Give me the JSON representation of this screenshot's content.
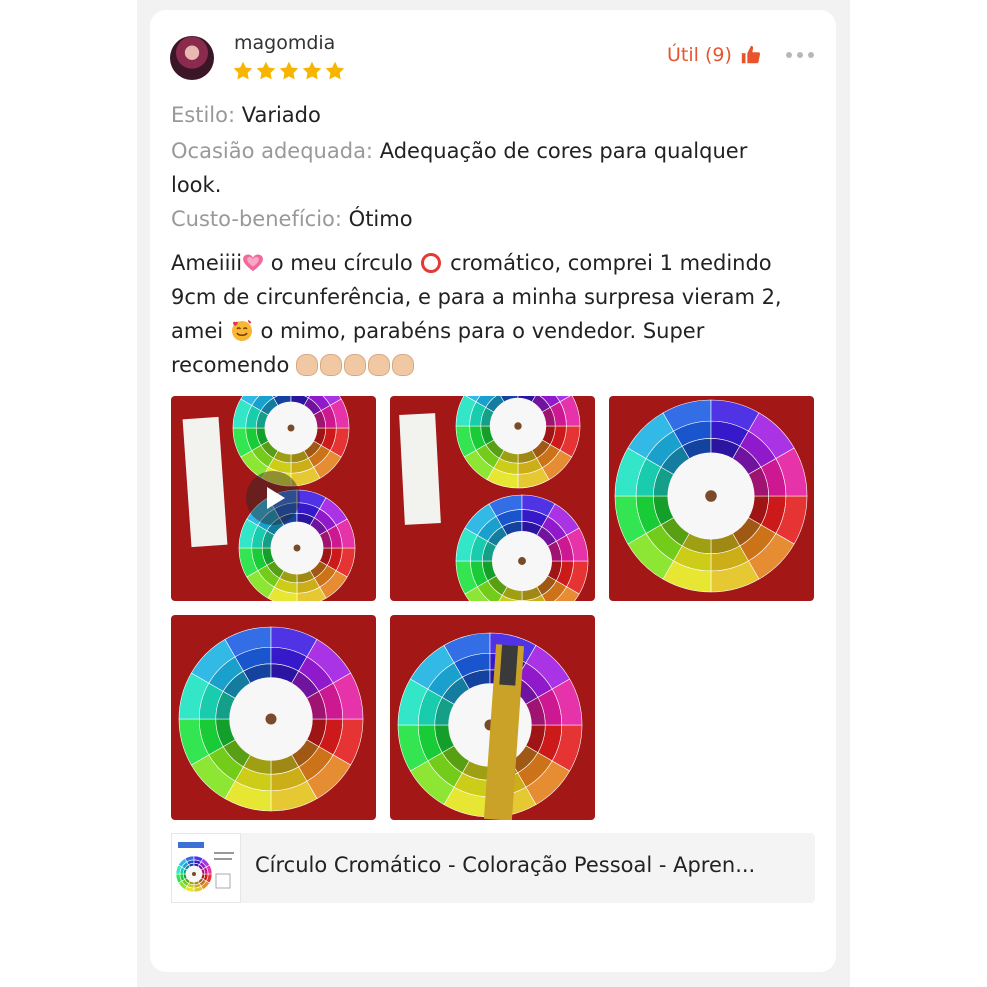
{
  "review": {
    "username": "magomdia",
    "rating": 5,
    "helpful_label": "Útil (9)",
    "attributes": [
      {
        "key": "Estilo:",
        "value": "Variado"
      },
      {
        "key": "Ocasião adequada:",
        "value": "Adequação de cores para qualquer look."
      },
      {
        "key": "Custo-benefício:",
        "value": "Ótimo"
      }
    ],
    "text_parts": [
      "Ameiiii",
      " o meu círculo ",
      " cromático, comprei 1 medindo 9cm de circunferência, e para a minha surpresa vieram 2, amei ",
      " o mimo, parabéns para o vendedor. Super recomendo "
    ],
    "emojis": [
      "growing-heart",
      "red-circle",
      "smiling-face-with-hearts",
      "clapping-hands"
    ],
    "photos": [
      {
        "kind": "video"
      },
      {
        "kind": "image"
      },
      {
        "kind": "image"
      },
      {
        "kind": "image"
      },
      {
        "kind": "image"
      }
    ]
  },
  "product": {
    "title": "Círculo Cromático - Coloração Pessoal - Apren..."
  },
  "colors": {
    "accent": "#e8552d",
    "star": "#f7b500",
    "label_gray": "#999999",
    "photo_bg": "#a31717"
  }
}
